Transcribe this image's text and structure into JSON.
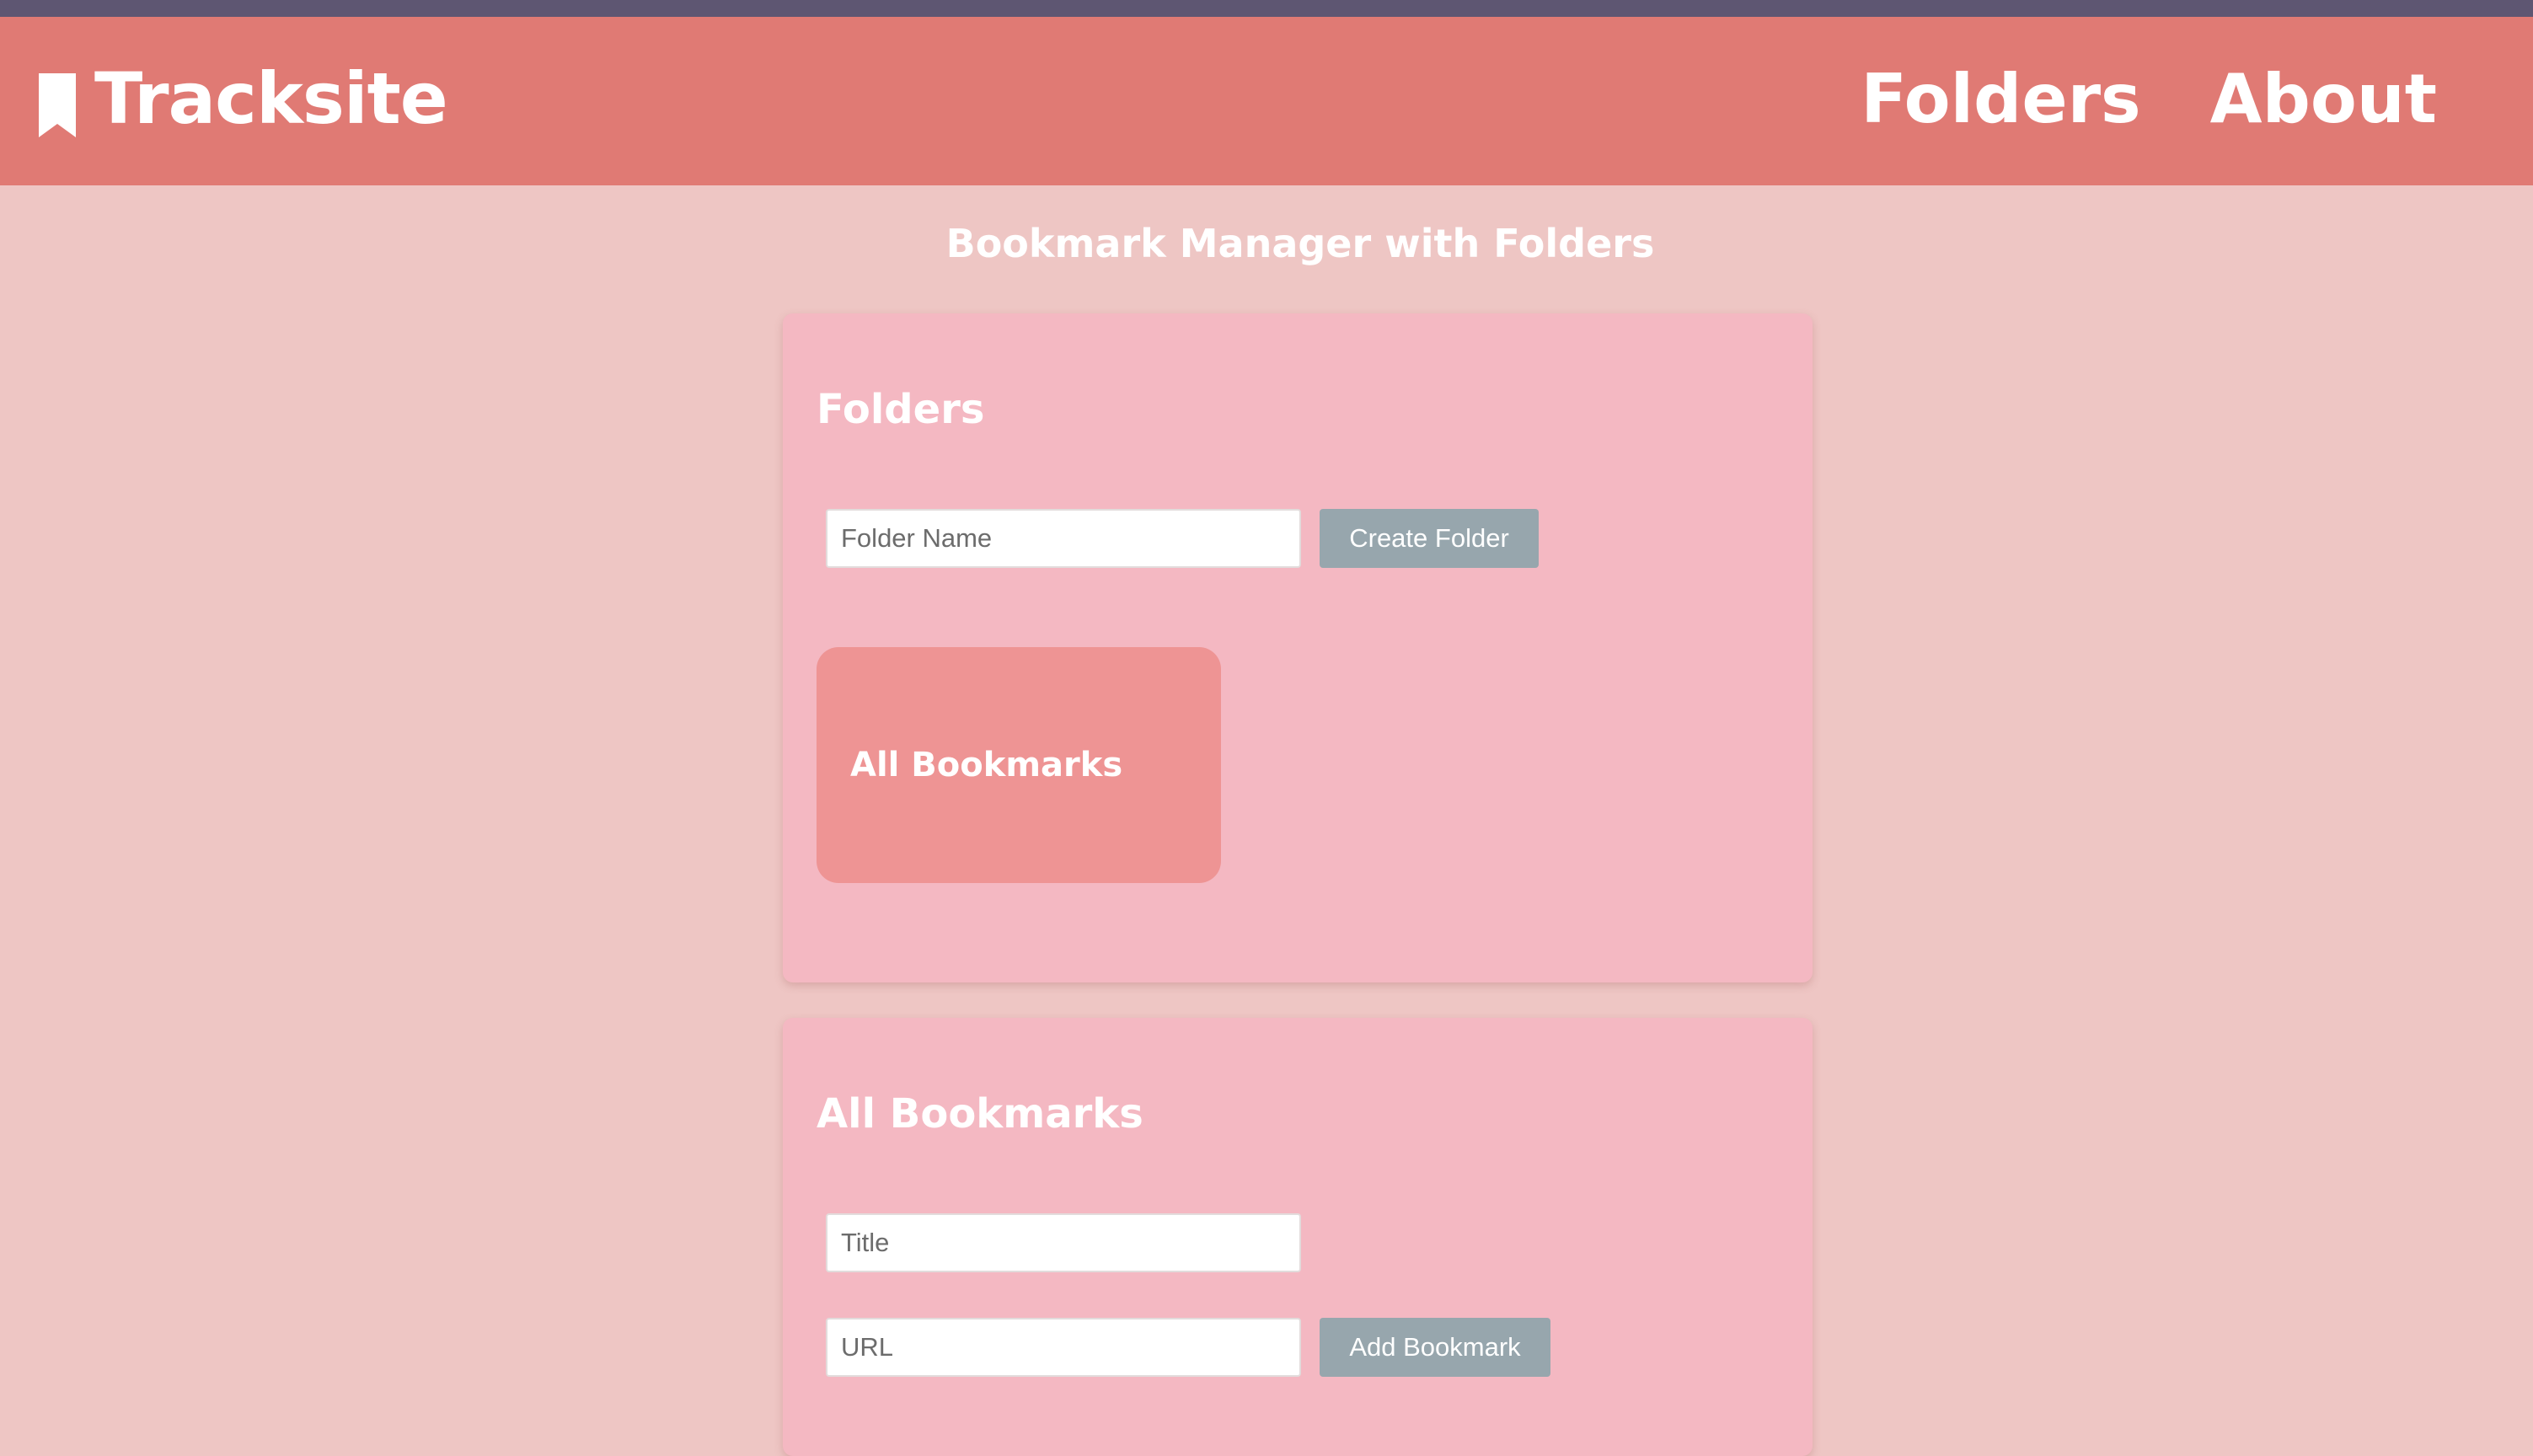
{
  "colors": {
    "browser_strip": "#5e5672",
    "navbar": "#e07a74",
    "page_background": "#eec6c4",
    "card_background": "#f4b8c2",
    "folder_tile": "#ee9494",
    "button": "#97a6ad"
  },
  "navbar": {
    "brand_icon": "bookmark-icon",
    "brand_name": "Tracksite",
    "links": [
      "Folders",
      "About"
    ]
  },
  "page": {
    "title": "Bookmark Manager with Folders"
  },
  "folders_card": {
    "heading": "Folders",
    "folder_name_placeholder": "Folder Name",
    "folder_name_value": "",
    "create_button_label": "Create Folder",
    "folders": [
      "All Bookmarks"
    ]
  },
  "bookmarks_card": {
    "heading": "All Bookmarks",
    "title_placeholder": "Title",
    "title_value": "",
    "url_placeholder": "URL",
    "url_value": "",
    "add_button_label": "Add Bookmark"
  }
}
